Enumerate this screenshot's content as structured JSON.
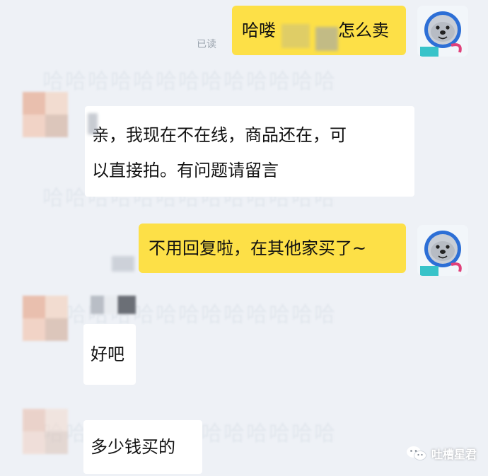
{
  "messages": [
    {
      "side": "out",
      "text_before": "哈喽",
      "text_after": "怎么卖",
      "status": "已读"
    },
    {
      "side": "in",
      "lines": [
        "亲，我现在不在线，商品还在，可",
        "以直接拍。有问题请留言"
      ]
    },
    {
      "side": "out",
      "text": "不用回复啦，在其他家买了~"
    },
    {
      "side": "in",
      "text": "好吧"
    },
    {
      "side": "in",
      "text": "多少钱买的"
    }
  ],
  "ghost_text": [
    "哈哈哈哈哈哈哈哈哈哈哈哈哈",
    "哈哈哈哈哈哈哈哈哈哈哈哈哈",
    "哈哈哈哈哈哈哈哈哈哈哈哈哈",
    "哈哈哈哈哈哈哈哈哈哈哈哈哈"
  ],
  "watermark": {
    "text": "吐槽星君",
    "icon": "wechat-icon"
  },
  "colors": {
    "outgoing_bubble": "#fde047",
    "incoming_bubble": "#ffffff",
    "background": "#eef1f6"
  },
  "icons": {
    "self_avatar": "seal-astronaut-avatar",
    "other_avatar": "pixelated-avatar"
  }
}
